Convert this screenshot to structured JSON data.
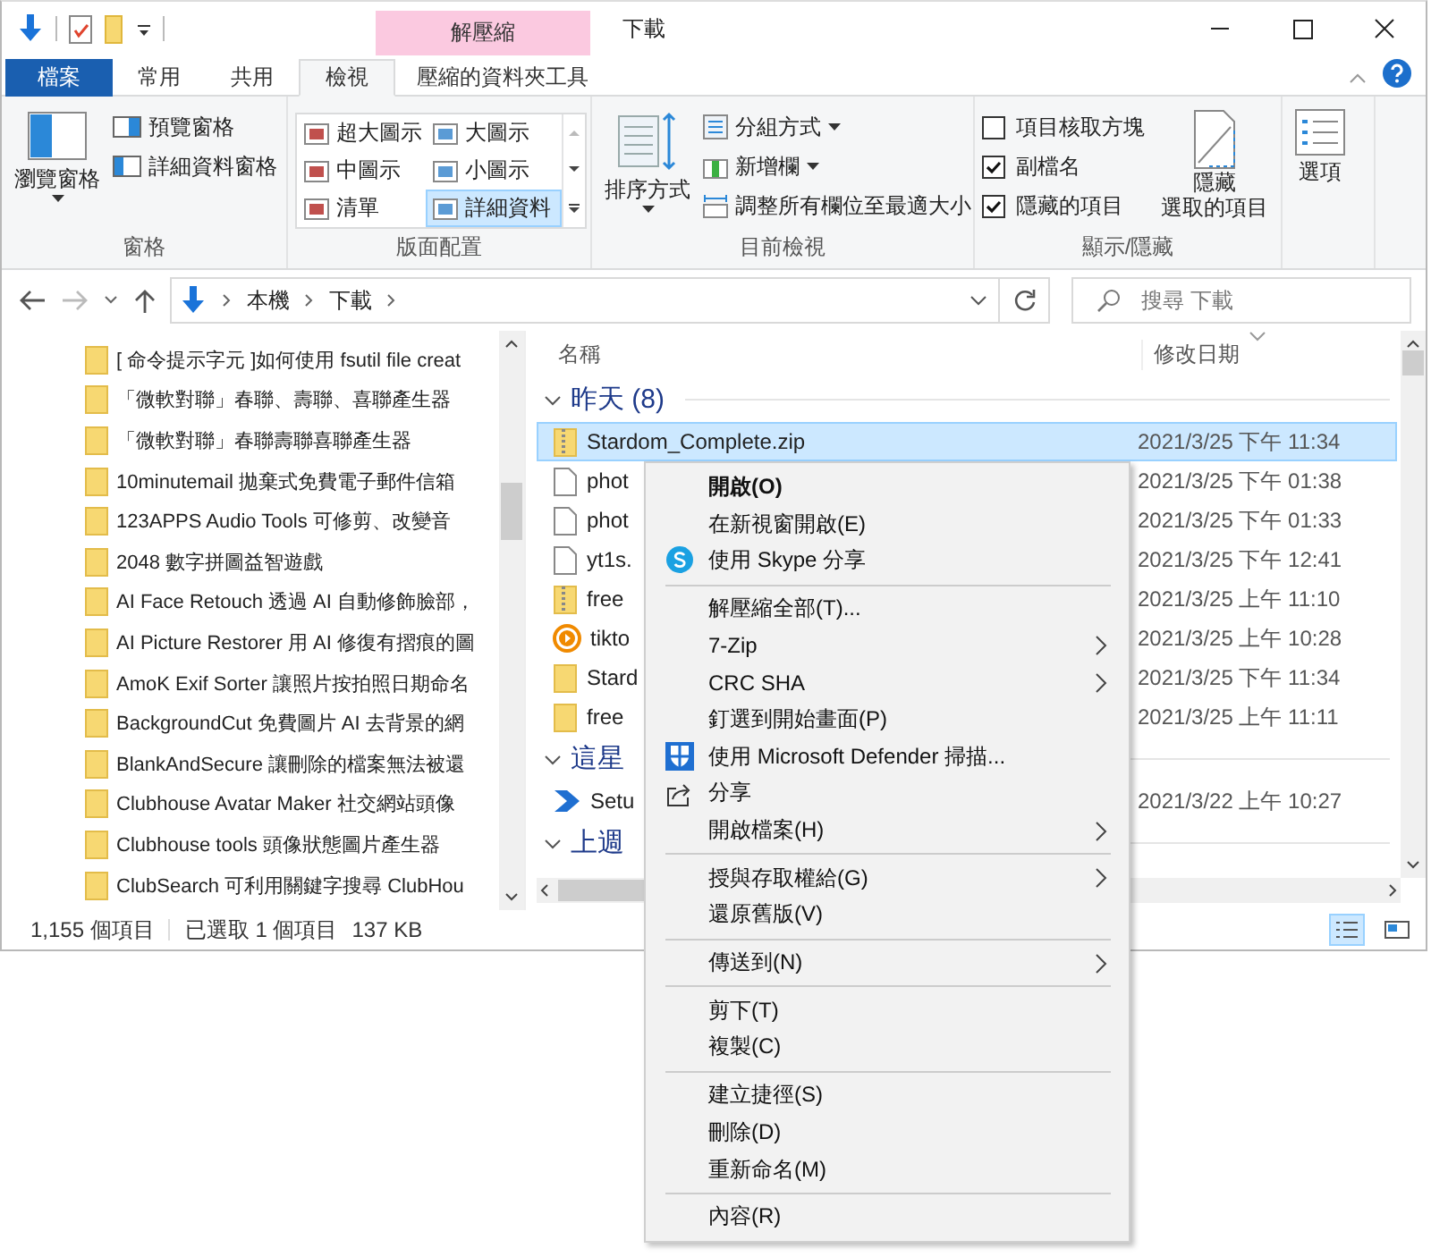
{
  "window": {
    "title": "下載"
  },
  "contextual_group": {
    "label": "解壓縮"
  },
  "tabs": [
    {
      "label": "檔案",
      "kind": "file",
      "selected": false
    },
    {
      "label": "常用",
      "kind": "tab",
      "selected": false
    },
    {
      "label": "共用",
      "kind": "tab",
      "selected": false
    },
    {
      "label": "檢視",
      "kind": "tab",
      "selected": true
    },
    {
      "label": "壓縮的資料夾工具",
      "kind": "contextual",
      "selected": false
    }
  ],
  "ribbon": {
    "panes": {
      "label": "窗格",
      "navigation_pane": "瀏覽窗格",
      "preview_pane": "預覽窗格",
      "details_pane": "詳細資料窗格"
    },
    "layout": {
      "label": "版面配置",
      "options": [
        {
          "label": "超大圖示",
          "selected": false
        },
        {
          "label": "大圖示",
          "selected": false
        },
        {
          "label": "中圖示",
          "selected": false
        },
        {
          "label": "小圖示",
          "selected": false
        },
        {
          "label": "清單",
          "selected": false
        },
        {
          "label": "詳細資料",
          "selected": true
        }
      ]
    },
    "current_view": {
      "label": "目前檢視",
      "sort_by": "排序方式",
      "group_by": "分組方式",
      "add_columns": "新增欄",
      "size_columns": "調整所有欄位至最適大小"
    },
    "show_hide": {
      "label": "顯示/隱藏",
      "checkboxes": [
        {
          "label": "項目核取方塊",
          "checked": false
        },
        {
          "label": "副檔名",
          "checked": true
        },
        {
          "label": "隱藏的項目",
          "checked": true
        }
      ],
      "hide_selected": [
        "隱藏",
        "選取的項目"
      ]
    },
    "options": "選項"
  },
  "address_bar": {
    "path": [
      "本機",
      "下載"
    ]
  },
  "search": {
    "placeholder": "搜尋 下載"
  },
  "navigation_pane": {
    "items": [
      "[ 命令提示字元 ]如何使用 fsutil file creat",
      "「微軟對聯」春聯、壽聯、喜聯產生器",
      "「微軟對聯」春聯壽聯喜聯產生器",
      "10minutemail  拋棄式免費電子郵件信箱",
      "123APPS Audio Tools 可修剪、改變音",
      "2048 數字拼圖益智遊戲",
      "AI Face Retouch 透過 AI 自動修飾臉部，",
      "AI Picture Restorer 用 AI 修復有摺痕的圖",
      "AmoK Exif Sorter 讓照片按拍照日期命名",
      "BackgroundCut 免費圖片 AI 去背景的網",
      "BlankAndSecure 讓刪除的檔案無法被還",
      "Clubhouse Avatar Maker 社交網站頭像",
      "Clubhouse tools 頭像狀態圖片產生器",
      "ClubSearch  可利用關鍵字搜尋 ClubHou"
    ]
  },
  "file_list": {
    "columns": [
      "名稱",
      "修改日期"
    ],
    "groups": [
      {
        "label": "昨天 (8)",
        "expanded": true,
        "rows": [
          {
            "name": "Stardom_Complete.zip",
            "date": "2021/3/25 下午 11:34",
            "kind": "zip",
            "selected": true
          },
          {
            "name": "phot",
            "date": "2021/3/25 下午 01:38",
            "kind": "file",
            "selected": false
          },
          {
            "name": "phot",
            "date": "2021/3/25 下午 01:33",
            "kind": "file",
            "selected": false
          },
          {
            "name": "yt1s.",
            "date": "2021/3/25 下午 12:41",
            "kind": "file",
            "selected": false
          },
          {
            "name": "free",
            "date": "2021/3/25 上午 11:10",
            "kind": "zip",
            "selected": false
          },
          {
            "name": "tikto",
            "date": "2021/3/25 上午 10:28",
            "kind": "media",
            "selected": false
          },
          {
            "name": "Stard",
            "date": "2021/3/25 下午 11:34",
            "kind": "folder",
            "selected": false
          },
          {
            "name": "free",
            "date": "2021/3/25 上午 11:11",
            "kind": "folder",
            "selected": false
          }
        ]
      },
      {
        "label": "這星",
        "expanded": true,
        "rows": [
          {
            "name": "Setu",
            "date": "2021/3/22 上午 10:27",
            "kind": "setup",
            "selected": false
          }
        ]
      },
      {
        "label": "上週",
        "expanded": true
      }
    ]
  },
  "status_bar": {
    "item_count": "1,155 個項目",
    "selection": "已選取 1 個項目",
    "size": "137 KB"
  },
  "view_buttons": [
    {
      "kind": "details",
      "selected": true
    },
    {
      "kind": "tiles",
      "selected": false
    }
  ],
  "context_menu": [
    {
      "kind": "plain",
      "label": "開啟(O)",
      "default": true,
      "submenu": false
    },
    {
      "kind": "plain",
      "label": "在新視窗開啟(E)",
      "default": false,
      "submenu": false
    },
    {
      "kind": "skype",
      "label": "使用 Skype 分享",
      "default": false,
      "submenu": false
    },
    {
      "kind": "separator"
    },
    {
      "kind": "plain",
      "label": "解壓縮全部(T)...",
      "default": false,
      "submenu": false
    },
    {
      "kind": "plain",
      "label": "7-Zip",
      "default": false,
      "submenu": true
    },
    {
      "kind": "plain",
      "label": "CRC SHA",
      "default": false,
      "submenu": true
    },
    {
      "kind": "plain",
      "label": "釘選到開始畫面(P)",
      "default": false,
      "submenu": false
    },
    {
      "kind": "defender",
      "label": "使用 Microsoft Defender 掃描...",
      "default": false,
      "submenu": false
    },
    {
      "kind": "share",
      "label": "分享",
      "default": false,
      "submenu": false
    },
    {
      "kind": "plain",
      "label": "開啟檔案(H)",
      "default": false,
      "submenu": true
    },
    {
      "kind": "separator"
    },
    {
      "kind": "plain",
      "label": "授與存取權給(G)",
      "default": false,
      "submenu": true
    },
    {
      "kind": "plain",
      "label": "還原舊版(V)",
      "default": false,
      "submenu": false
    },
    {
      "kind": "separator"
    },
    {
      "kind": "plain",
      "label": "傳送到(N)",
      "default": false,
      "submenu": true
    },
    {
      "kind": "separator"
    },
    {
      "kind": "plain",
      "label": "剪下(T)",
      "default": false,
      "submenu": false
    },
    {
      "kind": "plain",
      "label": "複製(C)",
      "default": false,
      "submenu": false
    },
    {
      "kind": "separator"
    },
    {
      "kind": "plain",
      "label": "建立捷徑(S)",
      "default": false,
      "submenu": false
    },
    {
      "kind": "plain",
      "label": "刪除(D)",
      "default": false,
      "submenu": false
    },
    {
      "kind": "plain",
      "label": "重新命名(M)",
      "default": false,
      "submenu": false
    },
    {
      "kind": "separator"
    },
    {
      "kind": "plain",
      "label": "內容(R)",
      "default": false,
      "submenu": false
    }
  ]
}
